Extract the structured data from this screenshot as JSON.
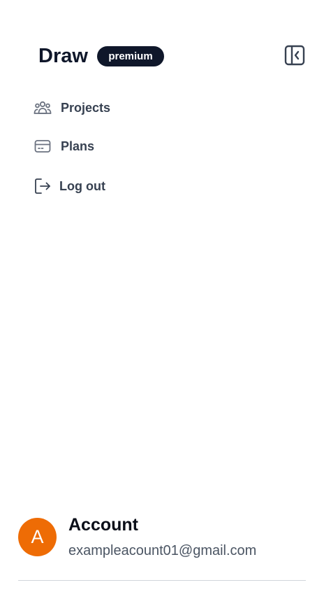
{
  "header": {
    "title": "Draw",
    "badge": "premium",
    "collapse_icon": "sidebar-collapse-icon"
  },
  "nav": {
    "items": [
      {
        "label": "Projects",
        "icon": "users-icon"
      },
      {
        "label": "Plans",
        "icon": "credit-card-icon"
      },
      {
        "label": "Log out",
        "icon": "logout-icon"
      }
    ]
  },
  "account": {
    "avatar_letter": "A",
    "avatar_color": "#ee6c05",
    "name": "Account",
    "email": "exampleacount01@gmail.com"
  },
  "colors": {
    "badge_bg": "#0f172a",
    "text_primary": "#0f172a",
    "nav_text": "#374151"
  }
}
